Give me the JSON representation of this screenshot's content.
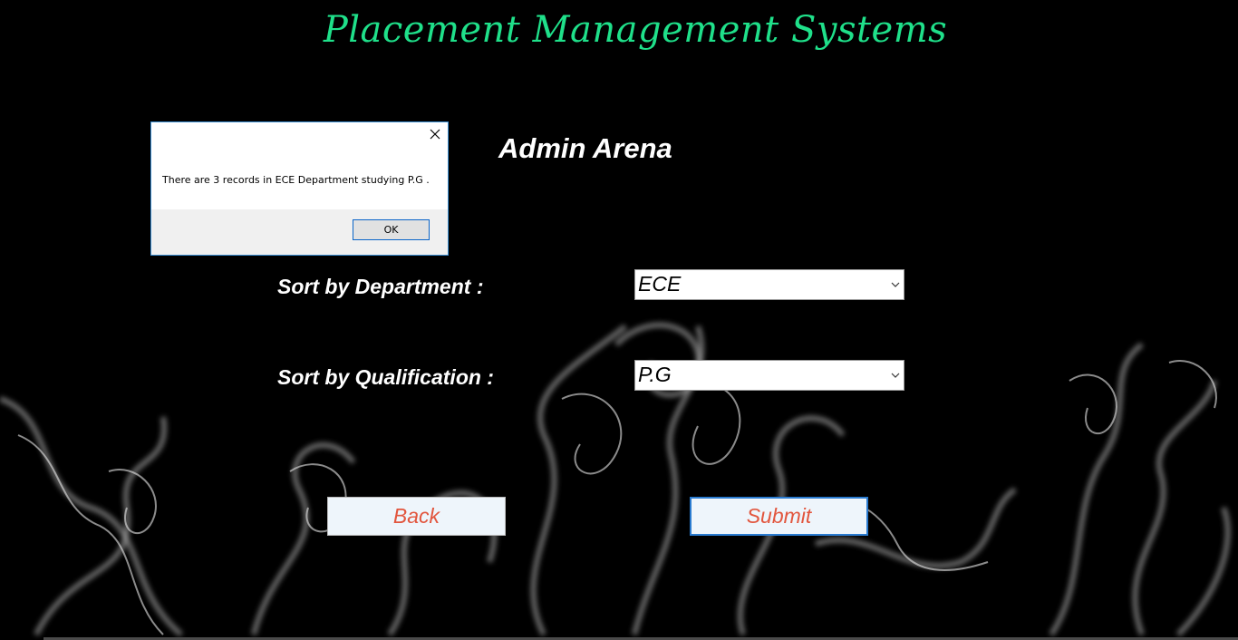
{
  "app_title": "Placement Management Systems",
  "section_title": "Admin Arena",
  "form": {
    "department_label": "Sort by Department :",
    "department_value": "ECE",
    "qualification_label": "Sort by Qualification :",
    "qualification_value": "P.G"
  },
  "buttons": {
    "back": "Back",
    "submit": "Submit"
  },
  "dialog": {
    "message": "There are 3 records in ECE Department studying P.G .",
    "ok_label": "OK"
  },
  "colors": {
    "title": "#1fe08a",
    "button_text": "#e2563e",
    "accent": "#2a7bd0"
  }
}
